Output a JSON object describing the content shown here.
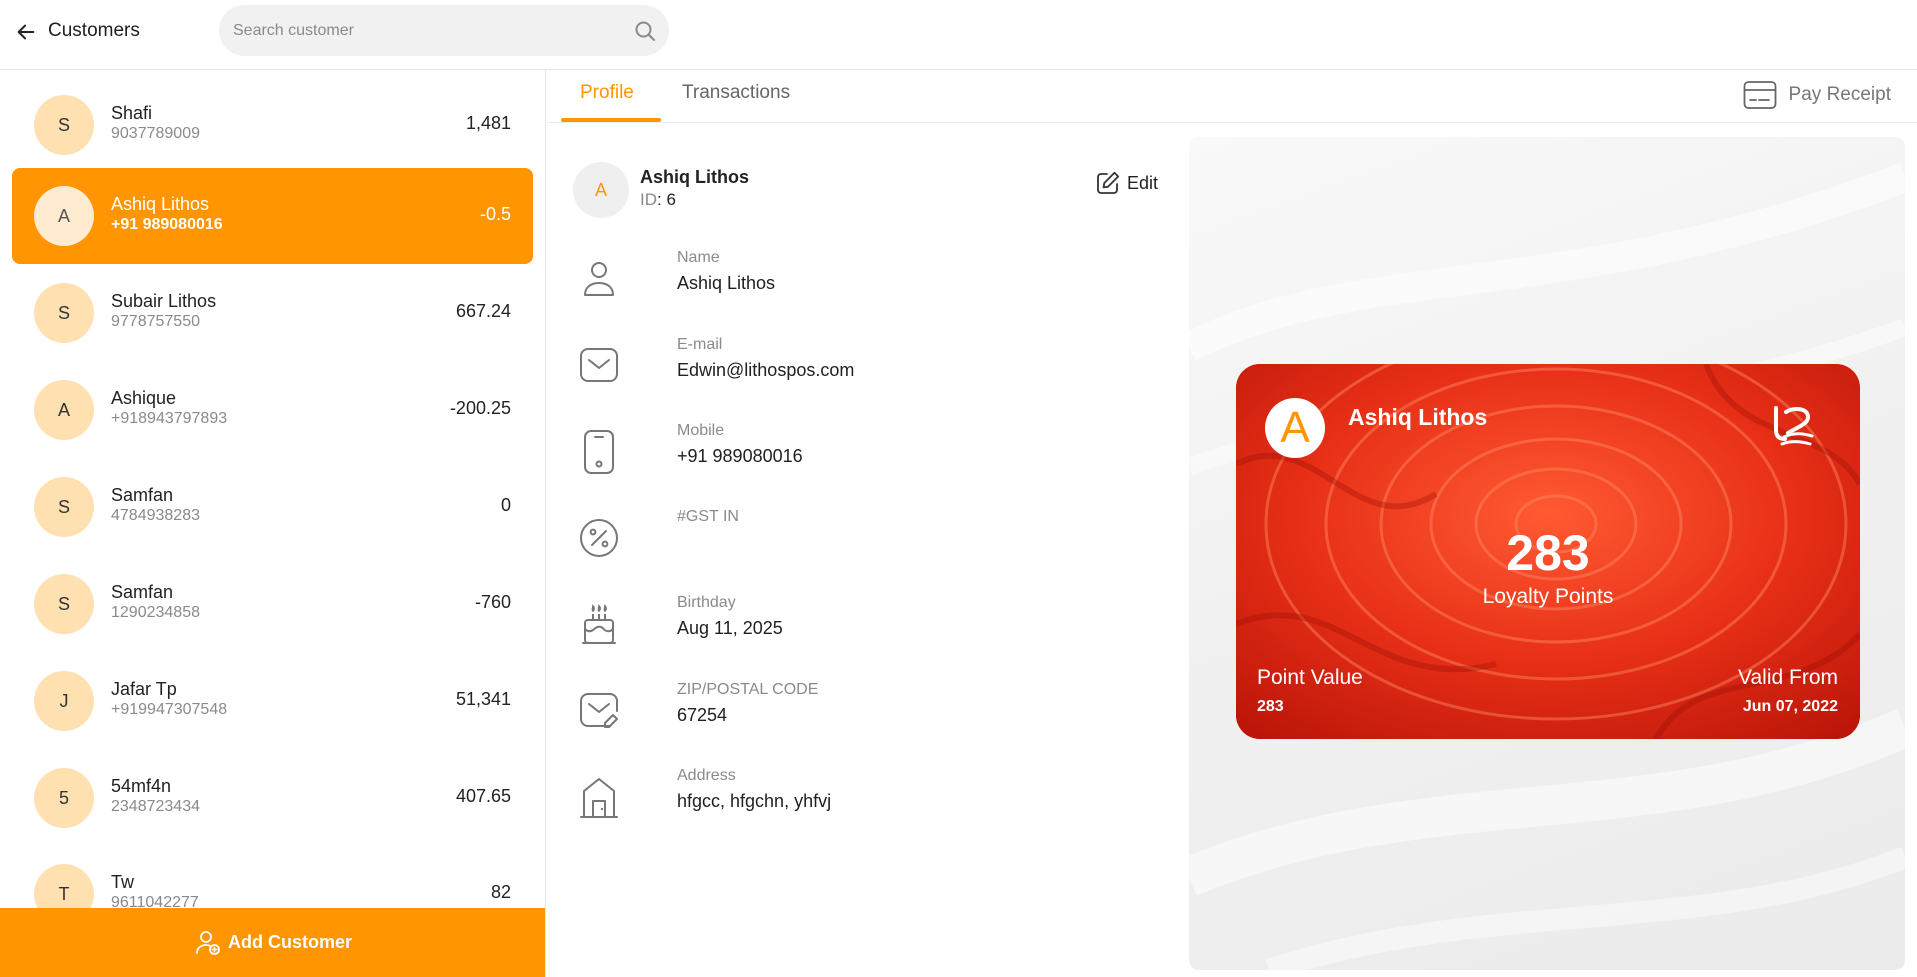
{
  "header": {
    "title": "Customers",
    "search_placeholder": "Search customer",
    "search_value": ""
  },
  "customers": [
    {
      "initial": "S",
      "name": "Shafi",
      "phone": "9037789009",
      "balance": "1,481",
      "active": false
    },
    {
      "initial": "A",
      "name": "Ashiq Lithos",
      "phone": "+91 989080016",
      "balance": "-0.5",
      "active": true
    },
    {
      "initial": "S",
      "name": "Subair Lithos",
      "phone": "9778757550",
      "balance": "667.24",
      "active": false
    },
    {
      "initial": "A",
      "name": "Ashique",
      "phone": "+918943797893",
      "balance": "-200.25",
      "active": false
    },
    {
      "initial": "S",
      "name": "Samfan",
      "phone": "4784938283",
      "balance": "0",
      "active": false
    },
    {
      "initial": "S",
      "name": "Samfan",
      "phone": "1290234858",
      "balance": "-760",
      "active": false
    },
    {
      "initial": "J",
      "name": "Jafar Tp",
      "phone": "+919947307548",
      "balance": "51,341",
      "active": false
    },
    {
      "initial": "5",
      "name": "54mf4n",
      "phone": "2348723434",
      "balance": "407.65",
      "active": false
    },
    {
      "initial": "T",
      "name": "Tw",
      "phone": "9611042277",
      "balance": "82",
      "active": false
    }
  ],
  "add_customer_label": "Add Customer",
  "tabs": [
    {
      "label": "Profile",
      "active": true
    },
    {
      "label": "Transactions",
      "active": false
    }
  ],
  "pay_receipt_label": "Pay Receipt",
  "profile": {
    "initial": "A",
    "name": "Ashiq Lithos",
    "id_label": "ID",
    "id_value": "6",
    "edit_label": "Edit",
    "fields": [
      {
        "icon": "person-icon",
        "label": "Name",
        "value": "Ashiq Lithos"
      },
      {
        "icon": "envelope-icon",
        "label": "E-mail",
        "value": "Edwin@lithospos.com"
      },
      {
        "icon": "mobile-icon",
        "label": "Mobile",
        "value": "+91 989080016"
      },
      {
        "icon": "percent-icon",
        "label": "#GST IN",
        "value": ""
      },
      {
        "icon": "cake-icon",
        "label": "Birthday",
        "value": "Aug 11, 2025"
      },
      {
        "icon": "mail-edit-icon",
        "label": "ZIP/POSTAL CODE",
        "value": "67254"
      },
      {
        "icon": "house-icon",
        "label": "Address",
        "value": "hfgcc, hfgchn, yhfvj"
      }
    ]
  },
  "loyalty_card": {
    "initial": "A",
    "name": "Ashiq Lithos",
    "points": "283",
    "points_label": "Loyalty Points",
    "point_value_label": "Point Value",
    "point_value": "283",
    "valid_from_label": "Valid From",
    "valid_from": "Jun 07, 2022"
  },
  "colors": {
    "accent": "#ff9500",
    "avatar_bg": "#ffe0b0",
    "card_red": "#d41d0c"
  }
}
